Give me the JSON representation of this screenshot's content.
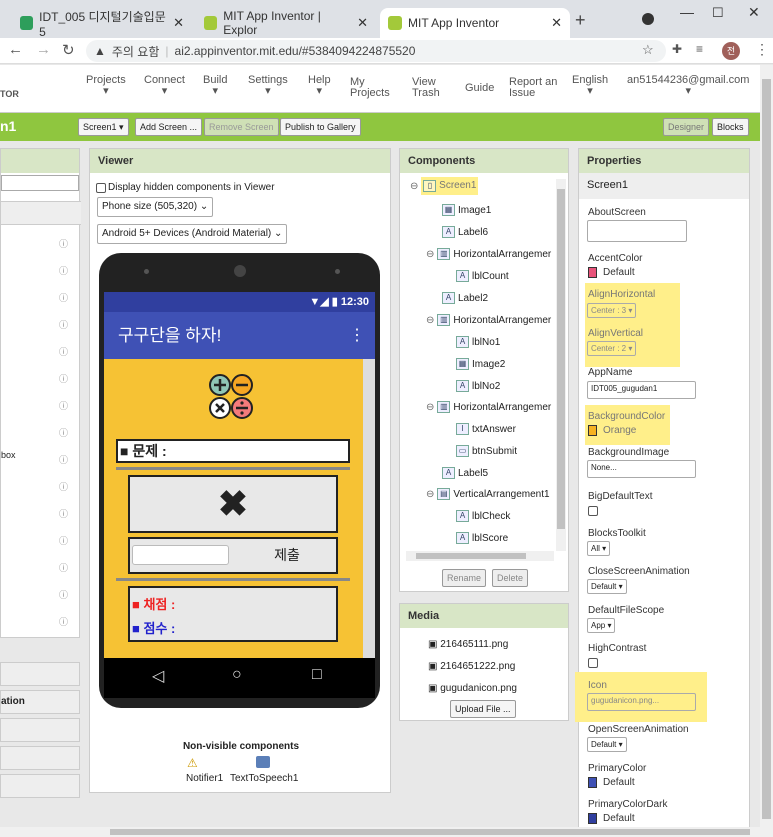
{
  "browser": {
    "tabs": [
      {
        "title": "IDT_005 디지털기술입문 5"
      },
      {
        "title": "MIT App Inventor | Explor"
      },
      {
        "title": "MIT App Inventor"
      }
    ],
    "warning": "주의 요함",
    "url": "ai2.appinventor.mit.edu/#5384094224875520",
    "profile": "전"
  },
  "nav": {
    "logo_text": "TOR",
    "items": [
      "Projects",
      "Connect",
      "Build",
      "Settings",
      "Help",
      "My Projects",
      "View Trash",
      "Guide",
      "Report an Issue",
      "English",
      "an51544236@gmail.com"
    ]
  },
  "toolbar": {
    "screen_name": "n1",
    "screen_select": "Screen1 ▾",
    "add_screen": "Add Screen ...",
    "remove_screen": "Remove Screen",
    "publish": "Publish to Gallery",
    "designer": "Designer",
    "blocks": "Blocks"
  },
  "palette": {
    "frag_box": "box",
    "frag_animation": "ation"
  },
  "viewer": {
    "title": "Viewer",
    "hidden_checkbox": "Display hidden components in Viewer",
    "phone_size": "Phone size (505,320)",
    "theme": "Android 5+ Devices (Android Material)",
    "status_time": "12:30",
    "app_title": "구구단을 하자!",
    "problem_label": "■ 문제 :",
    "submit_label": "제출",
    "score_grading": "■ 채점 :",
    "score_points": "■ 점수 :",
    "nonvisible_title": "Non-visible components",
    "nonvisible": [
      "Notifier1",
      "TextToSpeech1"
    ]
  },
  "components": {
    "title": "Components",
    "items": [
      "Screen1",
      "Image1",
      "Label6",
      "HorizontalArrangemer",
      "lblCount",
      "Label2",
      "HorizontalArrangemer",
      "lblNo1",
      "Image2",
      "lblNo2",
      "HorizontalArrangemer",
      "txtAnswer",
      "btnSubmit",
      "Label5",
      "VerticalArrangement1",
      "lblCheck",
      "lblScore"
    ],
    "rename": "Rename",
    "delete": "Delete"
  },
  "media": {
    "title": "Media",
    "files": [
      "216465111.png",
      "2164651222.png",
      "gugudanicon.png"
    ],
    "upload": "Upload File ..."
  },
  "properties": {
    "title": "Properties",
    "screen": "Screen1",
    "about_label": "AboutScreen",
    "accent_label": "AccentColor",
    "accent_value": "Default",
    "accent_color": "#e8537a",
    "alignh_label": "AlignHorizontal",
    "alignh_value": "Center : 3 ▾",
    "alignv_label": "AlignVertical",
    "alignv_value": "Center : 2 ▾",
    "appname_label": "AppName",
    "appname_value": "IDT005_gugudan1",
    "bg_label": "BackgroundColor",
    "bg_value": "Orange",
    "bg_color": "#f6b221",
    "bgimg_label": "BackgroundImage",
    "bgimg_value": "None...",
    "bigtext_label": "BigDefaultText",
    "toolkit_label": "BlocksToolkit",
    "toolkit_value": "All ▾",
    "closeanim_label": "CloseScreenAnimation",
    "closeanim_value": "Default ▾",
    "filescope_label": "DefaultFileScope",
    "filescope_value": "App ▾",
    "contrast_label": "HighContrast",
    "icon_label": "Icon",
    "icon_value": "gugudanicon.png...",
    "openanim_label": "OpenScreenAnimation",
    "openanim_value": "Default ▾",
    "primary_label": "PrimaryColor",
    "primary_value": "Default",
    "primary_color": "#3f51b5",
    "primarydark_label": "PrimaryColorDark",
    "primarydark_value": "Default",
    "primarydark_color": "#303f9f"
  }
}
